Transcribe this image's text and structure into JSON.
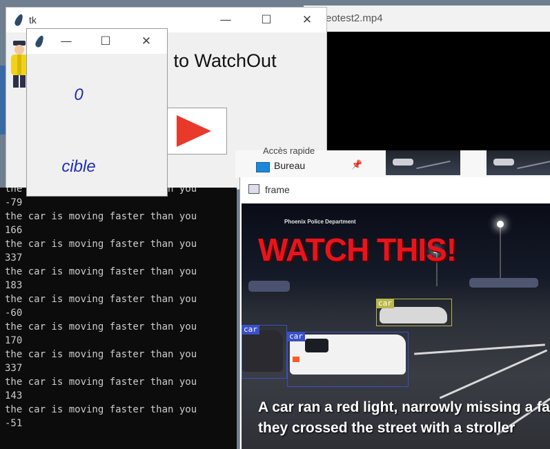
{
  "video_window": {
    "title": "eotest2.mp4"
  },
  "tk_window": {
    "title": "tk",
    "welcome_text": "e to WatchOut",
    "controls": {
      "minimize": "—",
      "maximize": "☐",
      "close": "✕"
    },
    "play_button_icon": "play-icon",
    "play_color": "#e8392a"
  },
  "small_window": {
    "controls": {
      "minimize": "—",
      "maximize": "☐",
      "close": "✕"
    },
    "counter_value": "0",
    "target_label": "cible",
    "text_color": "#1f2fb0"
  },
  "console": {
    "lines": [
      "the car is moving faster than you",
      "-79",
      "the car is moving faster than you",
      "166",
      "the car is moving faster than you",
      "337",
      "the car is moving faster than you",
      "183",
      "the car is moving faster than you",
      "-60",
      "the car is moving faster than you",
      "170",
      "the car is moving faster than you",
      "337",
      "the car is moving faster than you",
      "143",
      "the car is moving faster than you",
      "-51"
    ]
  },
  "explorer": {
    "quick_access": "Accès rapide",
    "desktop_item": "Bureau"
  },
  "frame_window": {
    "title": "frame",
    "source_label": "Phoenix Police Department",
    "headline": "WATCH THIS!",
    "headline_color": "#e8141c",
    "caption_line1": "A car ran a red light, narrowly missing a fa",
    "caption_line2": "they crossed the street with a stroller",
    "detections": [
      {
        "label": "car",
        "color": "#b8b84a"
      },
      {
        "label": "car",
        "color": "#3b4fc8"
      },
      {
        "label": "car",
        "color": "#3b4fc8"
      }
    ]
  }
}
